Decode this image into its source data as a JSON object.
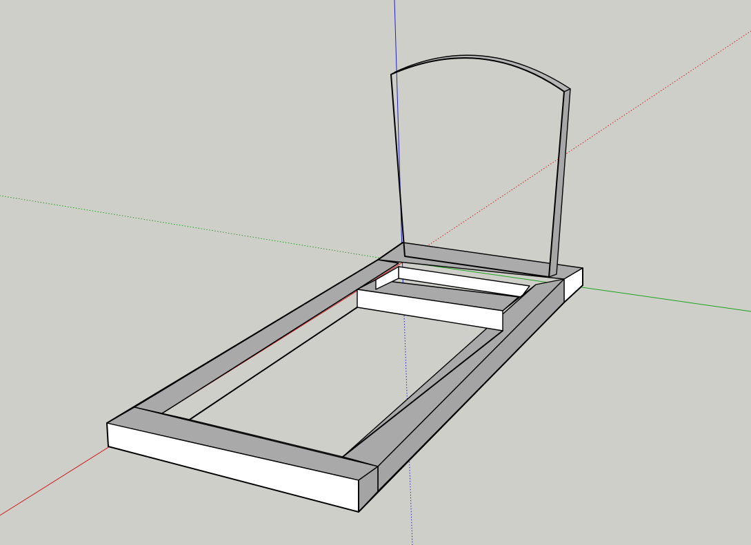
{
  "viewport": {
    "background_color": "#cfcfca",
    "axes": {
      "red_axis_color": "#d11e1e",
      "green_axis_color": "#1aa11a",
      "blue_axis_color": "#1e1ec8"
    },
    "model": {
      "name": "",
      "face_front_color": "#ffffff",
      "face_top_color": "#a9a9a9",
      "face_side_color": "#a0a0a0",
      "edge_color": "#000000"
    }
  }
}
